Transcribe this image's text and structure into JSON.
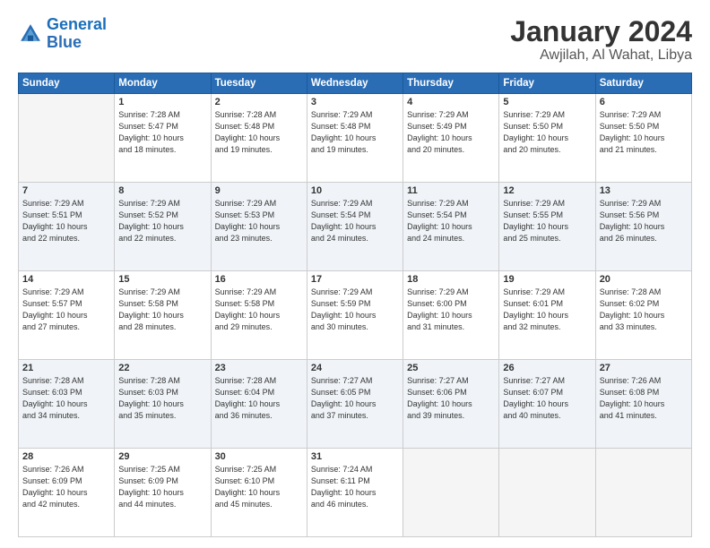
{
  "logo": {
    "text_general": "General",
    "text_blue": "Blue"
  },
  "title": "January 2024",
  "subtitle": "Awjilah, Al Wahat, Libya",
  "days_header": [
    "Sunday",
    "Monday",
    "Tuesday",
    "Wednesday",
    "Thursday",
    "Friday",
    "Saturday"
  ],
  "weeks": [
    {
      "shade": false,
      "days": [
        {
          "num": "",
          "empty": true
        },
        {
          "num": "1",
          "sunrise": "7:28 AM",
          "sunset": "5:47 PM",
          "daylight": "10 hours and 18 minutes."
        },
        {
          "num": "2",
          "sunrise": "7:28 AM",
          "sunset": "5:48 PM",
          "daylight": "10 hours and 19 minutes."
        },
        {
          "num": "3",
          "sunrise": "7:29 AM",
          "sunset": "5:48 PM",
          "daylight": "10 hours and 19 minutes."
        },
        {
          "num": "4",
          "sunrise": "7:29 AM",
          "sunset": "5:49 PM",
          "daylight": "10 hours and 20 minutes."
        },
        {
          "num": "5",
          "sunrise": "7:29 AM",
          "sunset": "5:50 PM",
          "daylight": "10 hours and 20 minutes."
        },
        {
          "num": "6",
          "sunrise": "7:29 AM",
          "sunset": "5:50 PM",
          "daylight": "10 hours and 21 minutes."
        }
      ]
    },
    {
      "shade": true,
      "days": [
        {
          "num": "7",
          "sunrise": "7:29 AM",
          "sunset": "5:51 PM",
          "daylight": "10 hours and 22 minutes."
        },
        {
          "num": "8",
          "sunrise": "7:29 AM",
          "sunset": "5:52 PM",
          "daylight": "10 hours and 22 minutes."
        },
        {
          "num": "9",
          "sunrise": "7:29 AM",
          "sunset": "5:53 PM",
          "daylight": "10 hours and 23 minutes."
        },
        {
          "num": "10",
          "sunrise": "7:29 AM",
          "sunset": "5:54 PM",
          "daylight": "10 hours and 24 minutes."
        },
        {
          "num": "11",
          "sunrise": "7:29 AM",
          "sunset": "5:54 PM",
          "daylight": "10 hours and 24 minutes."
        },
        {
          "num": "12",
          "sunrise": "7:29 AM",
          "sunset": "5:55 PM",
          "daylight": "10 hours and 25 minutes."
        },
        {
          "num": "13",
          "sunrise": "7:29 AM",
          "sunset": "5:56 PM",
          "daylight": "10 hours and 26 minutes."
        }
      ]
    },
    {
      "shade": false,
      "days": [
        {
          "num": "14",
          "sunrise": "7:29 AM",
          "sunset": "5:57 PM",
          "daylight": "10 hours and 27 minutes."
        },
        {
          "num": "15",
          "sunrise": "7:29 AM",
          "sunset": "5:58 PM",
          "daylight": "10 hours and 28 minutes."
        },
        {
          "num": "16",
          "sunrise": "7:29 AM",
          "sunset": "5:58 PM",
          "daylight": "10 hours and 29 minutes."
        },
        {
          "num": "17",
          "sunrise": "7:29 AM",
          "sunset": "5:59 PM",
          "daylight": "10 hours and 30 minutes."
        },
        {
          "num": "18",
          "sunrise": "7:29 AM",
          "sunset": "6:00 PM",
          "daylight": "10 hours and 31 minutes."
        },
        {
          "num": "19",
          "sunrise": "7:29 AM",
          "sunset": "6:01 PM",
          "daylight": "10 hours and 32 minutes."
        },
        {
          "num": "20",
          "sunrise": "7:28 AM",
          "sunset": "6:02 PM",
          "daylight": "10 hours and 33 minutes."
        }
      ]
    },
    {
      "shade": true,
      "days": [
        {
          "num": "21",
          "sunrise": "7:28 AM",
          "sunset": "6:03 PM",
          "daylight": "10 hours and 34 minutes."
        },
        {
          "num": "22",
          "sunrise": "7:28 AM",
          "sunset": "6:03 PM",
          "daylight": "10 hours and 35 minutes."
        },
        {
          "num": "23",
          "sunrise": "7:28 AM",
          "sunset": "6:04 PM",
          "daylight": "10 hours and 36 minutes."
        },
        {
          "num": "24",
          "sunrise": "7:27 AM",
          "sunset": "6:05 PM",
          "daylight": "10 hours and 37 minutes."
        },
        {
          "num": "25",
          "sunrise": "7:27 AM",
          "sunset": "6:06 PM",
          "daylight": "10 hours and 39 minutes."
        },
        {
          "num": "26",
          "sunrise": "7:27 AM",
          "sunset": "6:07 PM",
          "daylight": "10 hours and 40 minutes."
        },
        {
          "num": "27",
          "sunrise": "7:26 AM",
          "sunset": "6:08 PM",
          "daylight": "10 hours and 41 minutes."
        }
      ]
    },
    {
      "shade": false,
      "days": [
        {
          "num": "28",
          "sunrise": "7:26 AM",
          "sunset": "6:09 PM",
          "daylight": "10 hours and 42 minutes."
        },
        {
          "num": "29",
          "sunrise": "7:25 AM",
          "sunset": "6:09 PM",
          "daylight": "10 hours and 44 minutes."
        },
        {
          "num": "30",
          "sunrise": "7:25 AM",
          "sunset": "6:10 PM",
          "daylight": "10 hours and 45 minutes."
        },
        {
          "num": "31",
          "sunrise": "7:24 AM",
          "sunset": "6:11 PM",
          "daylight": "10 hours and 46 minutes."
        },
        {
          "num": "",
          "empty": true
        },
        {
          "num": "",
          "empty": true
        },
        {
          "num": "",
          "empty": true
        }
      ]
    }
  ],
  "labels": {
    "sunrise": "Sunrise:",
    "sunset": "Sunset:",
    "daylight": "Daylight:"
  }
}
